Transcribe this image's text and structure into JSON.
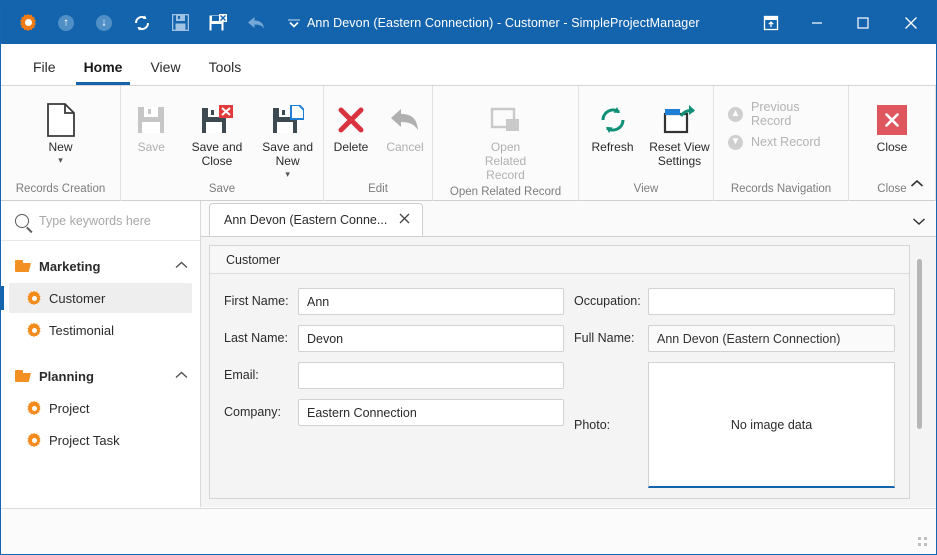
{
  "window": {
    "title": "Ann Devon (Eastern Connection) - Customer - SimpleProjectManager",
    "quick_access": [
      {
        "name": "app-gear-icon",
        "label": "Application Menu"
      },
      {
        "name": "arrow-up-circle-icon",
        "label": "Up",
        "glyph": "↑"
      },
      {
        "name": "arrow-down-circle-icon",
        "label": "Down",
        "glyph": "↓"
      },
      {
        "name": "refresh-icon",
        "label": "Refresh",
        "glyph": "⟳"
      },
      {
        "name": "save-icon",
        "label": "Save"
      },
      {
        "name": "save-and-close-icon",
        "label": "Save and Close"
      },
      {
        "name": "undo-icon",
        "label": "Undo",
        "glyph": "⬅"
      },
      {
        "name": "customize-qat-icon",
        "label": "Customize Quick Access Toolbar",
        "glyph": "⌄"
      }
    ],
    "controls": {
      "restore_layout": "⬚",
      "minimize": "—",
      "maximize": "☐",
      "close": "✕"
    }
  },
  "ribbon": {
    "tabs": [
      {
        "label": "File",
        "active": false
      },
      {
        "label": "Home",
        "active": true
      },
      {
        "label": "View",
        "active": false
      },
      {
        "label": "Tools",
        "active": false
      }
    ],
    "collapse_glyph": "∧",
    "groups": [
      {
        "name": "records-creation",
        "label": "Records Creation",
        "buttons": [
          {
            "name": "new-button",
            "label": "New",
            "disabled": false,
            "dropdown": true
          }
        ]
      },
      {
        "name": "save",
        "label": "Save",
        "buttons": [
          {
            "name": "save-button",
            "label": "Save",
            "disabled": true,
            "dropdown": false
          },
          {
            "name": "save-and-close-button",
            "label": "Save and Close",
            "disabled": false,
            "dropdown": false
          },
          {
            "name": "save-and-new-button",
            "label": "Save and New",
            "disabled": false,
            "dropdown": true
          }
        ]
      },
      {
        "name": "edit",
        "label": "Edit",
        "buttons": [
          {
            "name": "delete-button",
            "label": "Delete",
            "disabled": false,
            "dropdown": false
          },
          {
            "name": "cancel-button",
            "label": "Cancel",
            "disabled": true,
            "dropdown": false
          }
        ]
      },
      {
        "name": "open-related-record",
        "label": "Open Related Record",
        "buttons": [
          {
            "name": "open-related-record-button",
            "label": "Open Related Record",
            "disabled": true,
            "dropdown": false
          }
        ]
      },
      {
        "name": "view",
        "label": "View",
        "buttons": [
          {
            "name": "refresh-button",
            "label": "Refresh",
            "disabled": false,
            "dropdown": false
          },
          {
            "name": "reset-view-settings-button",
            "label": "Reset View Settings",
            "disabled": false,
            "dropdown": false
          }
        ]
      },
      {
        "name": "records-navigation",
        "label": "Records Navigation",
        "buttons": [
          {
            "name": "previous-record-button",
            "label": "Previous Record",
            "disabled": true
          },
          {
            "name": "next-record-button",
            "label": "Next Record",
            "disabled": true
          }
        ]
      },
      {
        "name": "close",
        "label": "Close",
        "buttons": [
          {
            "name": "close-record-button",
            "label": "Close",
            "disabled": false,
            "dropdown": false
          }
        ]
      }
    ]
  },
  "sidebar": {
    "search": {
      "placeholder": "Type keywords here",
      "value": ""
    },
    "groups": [
      {
        "name": "marketing",
        "label": "Marketing",
        "expanded": true,
        "chevron": "∧",
        "items": [
          {
            "name": "sidebar-item-customer",
            "label": "Customer",
            "selected": true
          },
          {
            "name": "sidebar-item-testimonial",
            "label": "Testimonial",
            "selected": false
          }
        ]
      },
      {
        "name": "planning",
        "label": "Planning",
        "expanded": true,
        "chevron": "∧",
        "items": [
          {
            "name": "sidebar-item-project",
            "label": "Project",
            "selected": false
          },
          {
            "name": "sidebar-item-project-task",
            "label": "Project Task",
            "selected": false
          }
        ]
      }
    ]
  },
  "document_tabs": {
    "tabs": [
      {
        "name": "document-tab-customer",
        "label": "Ann Devon (Eastern Conne...",
        "close_glyph": "✕",
        "active": true
      }
    ],
    "menu_glyph": "⌄"
  },
  "form": {
    "panel_title": "Customer",
    "left_fields": [
      {
        "name": "first-name-field",
        "label": "First Name:",
        "value": "Ann",
        "placeholder": ""
      },
      {
        "name": "last-name-field",
        "label": "Last Name:",
        "value": "Devon",
        "placeholder": ""
      },
      {
        "name": "email-field",
        "label": "Email:",
        "value": "",
        "placeholder": ""
      },
      {
        "name": "company-field",
        "label": "Company:",
        "value": "Eastern Connection",
        "placeholder": ""
      }
    ],
    "right_fields": [
      {
        "name": "occupation-field",
        "label": "Occupation:",
        "value": "",
        "placeholder": ""
      },
      {
        "name": "full-name-field",
        "label": "Full Name:",
        "value": "Ann Devon (Eastern Connection)",
        "placeholder": ""
      }
    ],
    "photo": {
      "name": "photo-box",
      "label": "Photo:",
      "empty_text": "No image data"
    }
  },
  "colors": {
    "titlebar": "#1464ad",
    "accent": "#1464ad",
    "orange": "#f28b1c",
    "danger": "#d9333f",
    "teal": "#0e8f76"
  },
  "statusbar": {
    "text": ""
  }
}
